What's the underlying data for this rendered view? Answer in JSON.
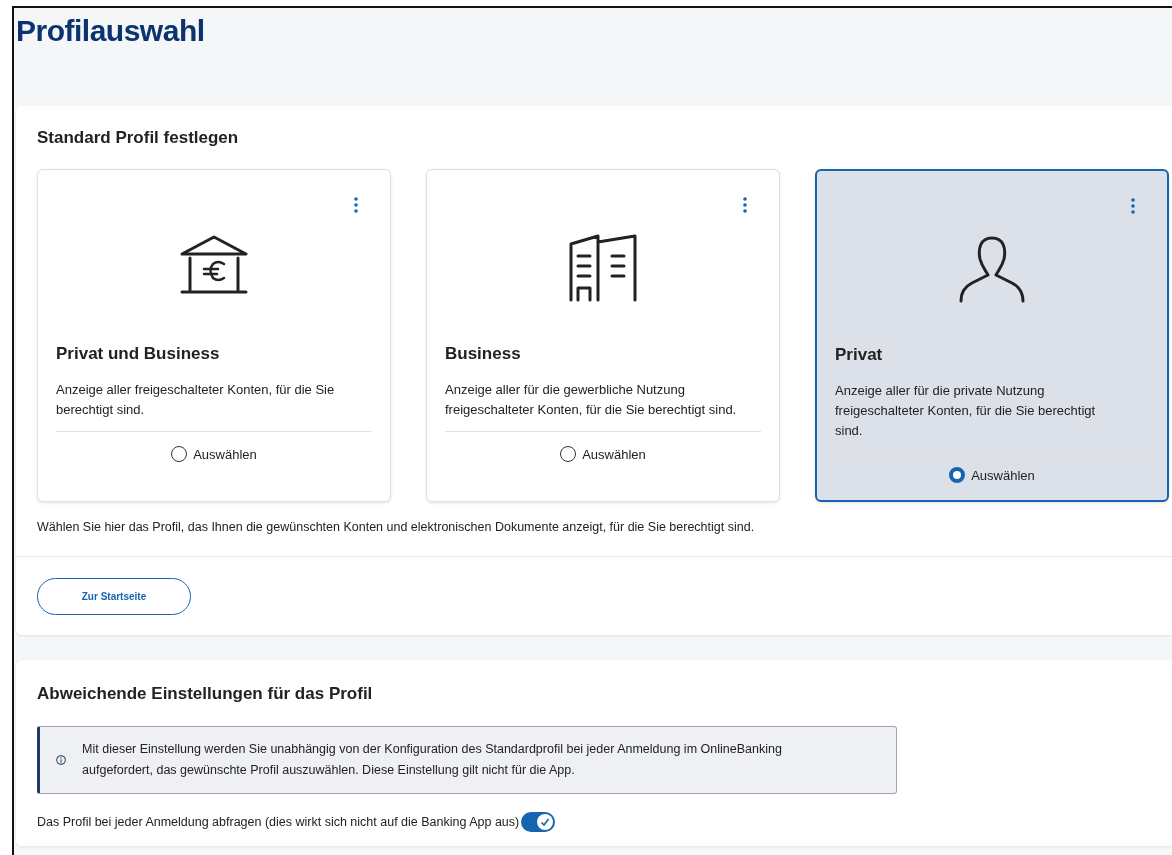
{
  "page": {
    "title": "Profilauswahl"
  },
  "standard_section": {
    "heading": "Standard Profil festlegen",
    "profiles": [
      {
        "kind": "bank",
        "title": "Privat und Business",
        "description": "Anzeige aller freigeschalteter Konten, für die Sie berechtigt sind.",
        "radio_label": "Auswählen",
        "selected": false
      },
      {
        "kind": "building",
        "title": "Business",
        "description": "Anzeige aller für die gewerbliche Nutzung freigeschalteter Konten, für die Sie berechtigt sind.",
        "radio_label": "Auswählen",
        "selected": false
      },
      {
        "kind": "person",
        "title": "Privat",
        "description": "Anzeige aller für die private Nutzung freigeschalteter Konten, für die Sie berechtigt sind.",
        "radio_label": "Auswählen",
        "selected": true
      }
    ],
    "hint": "Wählen Sie hier das Profil, das Ihnen die gewünschten Konten und elektronischen Dokumente anzeigt, für die Sie berechtigt sind.",
    "button": "Zur Startseite"
  },
  "override_section": {
    "heading": "Abweichende Einstellungen für das Profil",
    "info": "Mit dieser Einstellung werden Sie unabhängig von der Konfiguration des Standardprofil bei jeder Anmeldung im OnlineBanking aufgefordert, das gewünschte Profil auszuwählen. Diese Einstellung gilt nicht für die App.",
    "toggle_label": "Das Profil bei jeder Anmeldung abfragen (dies wirkt sich nicht auf die Banking App aus)",
    "toggle_on": true
  }
}
